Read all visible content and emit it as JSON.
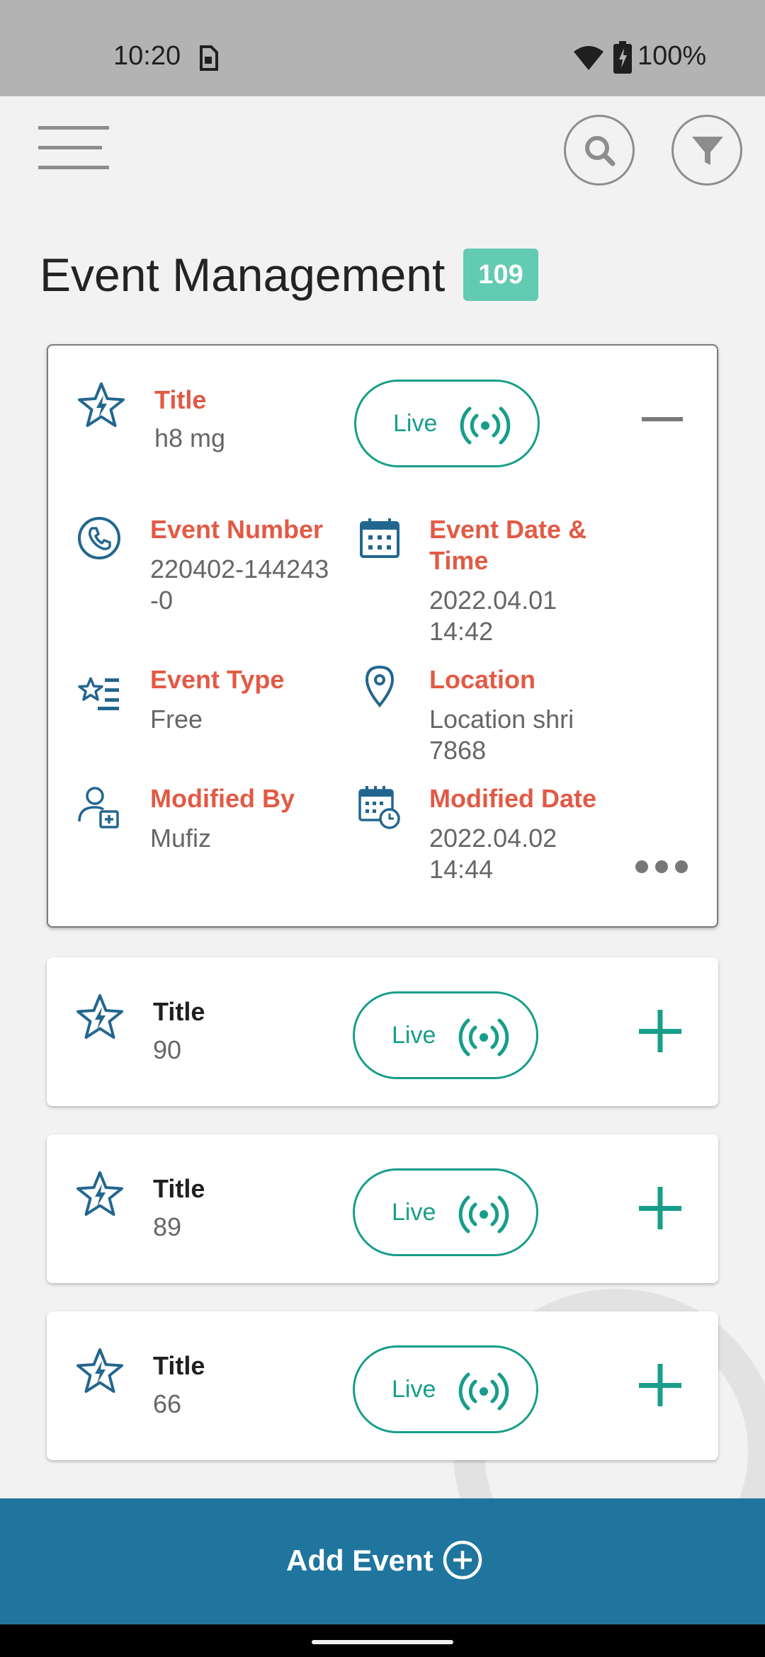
{
  "status_bar": {
    "time": "10:20",
    "battery": "100%"
  },
  "header": {
    "title": "Event Management",
    "count": "109"
  },
  "expanded_card": {
    "title_label": "Title",
    "title_value": "h8 mg",
    "live_label": "Live",
    "details": {
      "event_number": {
        "label": "Event Number",
        "value_line1": "220402-144243",
        "value_line2": "-0"
      },
      "event_datetime": {
        "label_line1": "Event Date &",
        "label_line2": "Time",
        "value_line1": "2022.04.01",
        "value_line2": "14:42"
      },
      "event_type": {
        "label": "Event Type",
        "value": "Free"
      },
      "location": {
        "label": "Location",
        "value_line1": "Location shri",
        "value_line2": "7868"
      },
      "modified_by": {
        "label": "Modified By",
        "value": "Mufiz"
      },
      "modified_date": {
        "label": "Modified Date",
        "value_line1": "2022.04.02",
        "value_line2": "14:44"
      }
    }
  },
  "events": [
    {
      "title_label": "Title",
      "title_value": "90",
      "live_label": "Live"
    },
    {
      "title_label": "Title",
      "title_value": "89",
      "live_label": "Live"
    },
    {
      "title_label": "Title",
      "title_value": "66",
      "live_label": "Live"
    }
  ],
  "footer": {
    "add_label": "Add Event"
  },
  "icons": {
    "menu": "menu-icon",
    "search": "search-icon",
    "filter": "filter-icon",
    "favorite": "star-icon",
    "live": "broadcast-icon",
    "collapse": "minus-icon",
    "expand": "plus-icon",
    "phone": "phone-icon",
    "calendar": "calendar-icon",
    "event_type": "star-list-icon",
    "location": "location-pin-icon",
    "user_add": "user-add-icon",
    "calendar_clock": "calendar-clock-icon",
    "more": "more-horizontal-icon",
    "add_circle": "add-circle-icon"
  },
  "colors": {
    "accent_teal": "#179e8a",
    "label_red": "#e25a45",
    "icon_blue": "#22668f",
    "badge_green": "#62cbb1",
    "bottom_bar": "#1f759d"
  }
}
